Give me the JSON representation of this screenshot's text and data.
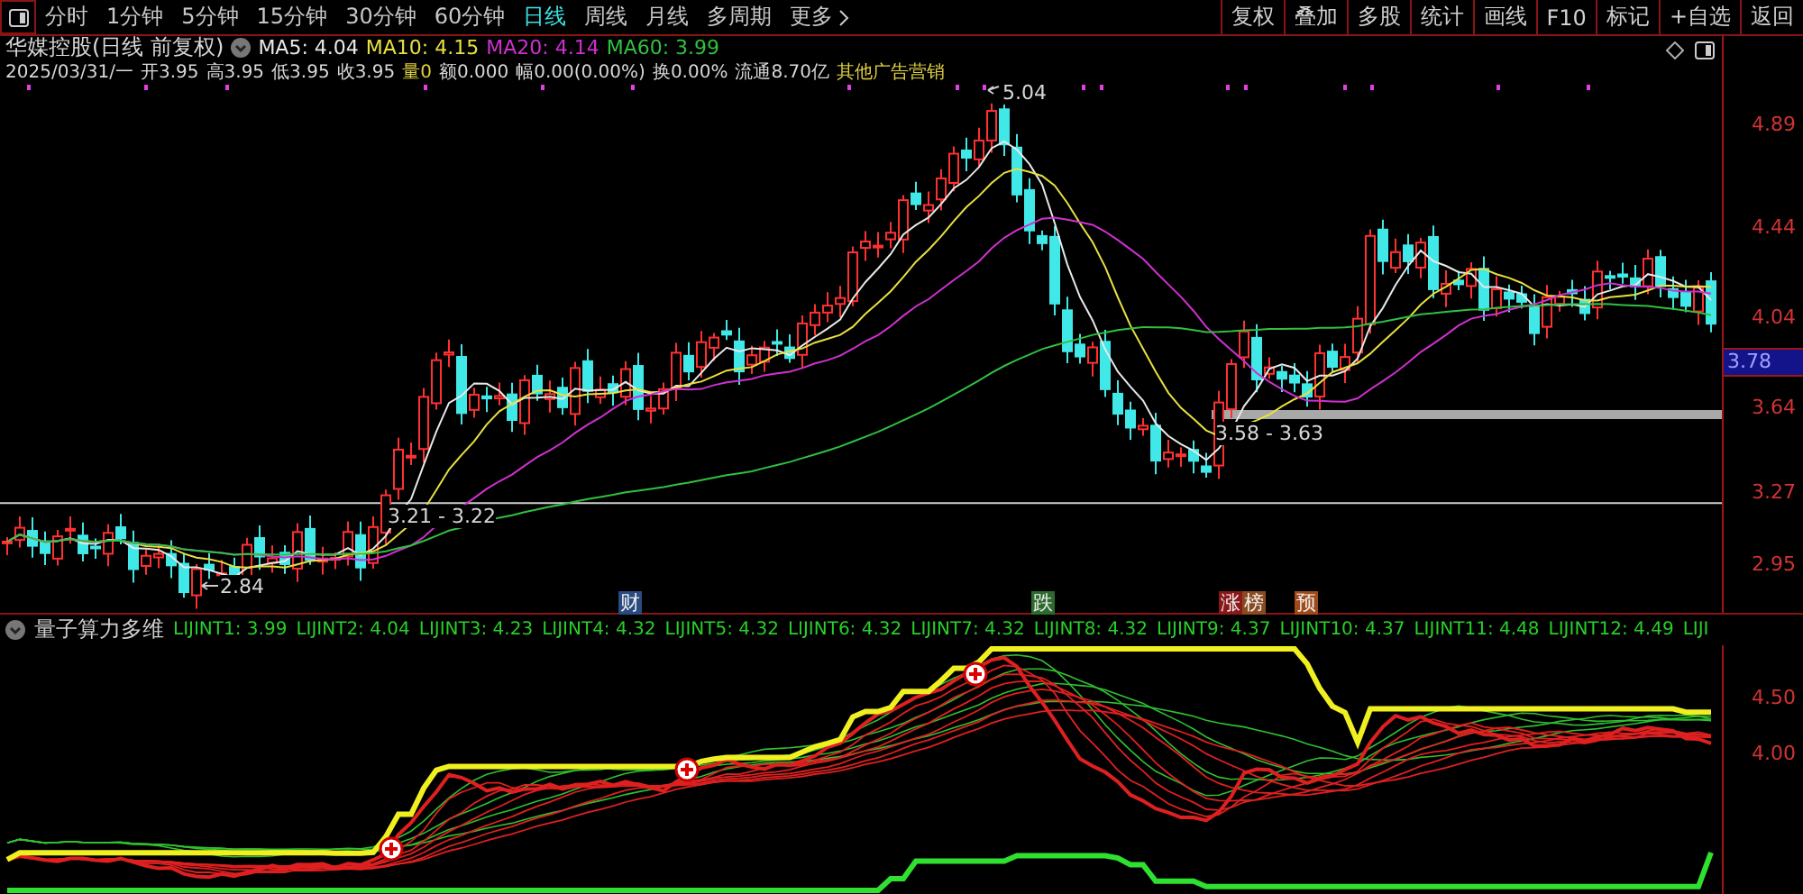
{
  "toolbar": {
    "periods": [
      {
        "label": "分时",
        "selected": false
      },
      {
        "label": "1分钟",
        "selected": false
      },
      {
        "label": "5分钟",
        "selected": false
      },
      {
        "label": "15分钟",
        "selected": false
      },
      {
        "label": "30分钟",
        "selected": false
      },
      {
        "label": "60分钟",
        "selected": false
      },
      {
        "label": "日线",
        "selected": true
      },
      {
        "label": "周线",
        "selected": false
      },
      {
        "label": "月线",
        "selected": false
      },
      {
        "label": "多周期",
        "selected": false
      }
    ],
    "more": "更多",
    "actions": [
      "复权",
      "叠加",
      "多股",
      "统计",
      "画线",
      "F10",
      "标记",
      "+自选",
      "返回"
    ]
  },
  "main_chart": {
    "title": "华媒控股(日线 前复权)",
    "moving_averages": [
      {
        "label": "MA5: 4.04",
        "color": "#e8e8e8"
      },
      {
        "label": "MA10: 4.15",
        "color": "#e8e040"
      },
      {
        "label": "MA20: 4.14",
        "color": "#d030d0"
      },
      {
        "label": "MA60: 3.99",
        "color": "#30c040"
      }
    ],
    "info": [
      {
        "text": "2025/03/31/一",
        "kind": "plain"
      },
      {
        "text": "开3.95",
        "kind": "plain"
      },
      {
        "text": "高3.95",
        "kind": "plain"
      },
      {
        "text": "低3.95",
        "kind": "plain"
      },
      {
        "text": "收3.95",
        "kind": "plain"
      },
      {
        "text": "量0",
        "kind": "highlight"
      },
      {
        "text": "额0.000",
        "kind": "plain"
      },
      {
        "text": "幅0.00(0.00%)",
        "kind": "plain"
      },
      {
        "text": "换0.00%",
        "kind": "plain"
      },
      {
        "text": "流通8.70亿",
        "kind": "plain"
      },
      {
        "text": "其他广告营销",
        "kind": "highlight"
      }
    ],
    "price_labels": [
      "5.04",
      "2.84",
      "3.21 - 3.22",
      "3.58 - 3.63"
    ],
    "events": [
      {
        "text": "财",
        "color": "#2a4a80"
      },
      {
        "text": "跌",
        "color": "#2e6a2e"
      },
      {
        "text": "涨",
        "color": "#8a1818"
      },
      {
        "text": "榜",
        "color": "#8a4a20"
      },
      {
        "text": "预",
        "color": "#a04a1a"
      }
    ],
    "axis_ticks": [
      "4.89",
      "4.44",
      "4.04",
      "3.64",
      "3.27",
      "2.95"
    ],
    "price_tag": "3.78"
  },
  "indicator": {
    "name": "量子算力多维",
    "values": [
      "LIJINT1: 3.99",
      "LIJINT2: 4.04",
      "LIJINT3: 4.23",
      "LIJINT4: 4.32",
      "LIJINT5: 4.32",
      "LIJINT6: 4.32",
      "LIJINT7: 4.32",
      "LIJINT8: 4.32",
      "LIJINT9: 4.37",
      "LIJINT10: 4.37",
      "LIJINT11: 4.48",
      "LIJINT12: 4.49",
      "LIJI"
    ],
    "axis_ticks": [
      "4.50",
      "4.00"
    ]
  }
}
